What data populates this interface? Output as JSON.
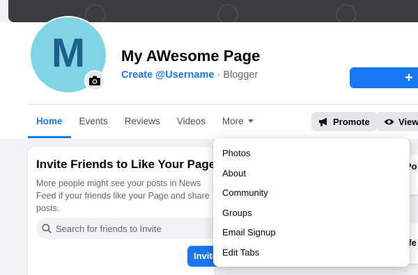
{
  "page": {
    "avatar_letter": "M",
    "name": "My AWesome Page",
    "username_link": "Create @Username",
    "separator": "·",
    "category": "Blogger",
    "primary_action_label": "+"
  },
  "nav": {
    "tabs": [
      {
        "label": "Home",
        "active": true
      },
      {
        "label": "Events"
      },
      {
        "label": "Reviews"
      },
      {
        "label": "Videos"
      },
      {
        "label": "More",
        "has_caret": true
      }
    ],
    "promote_label": "Promote",
    "view_label": "View"
  },
  "invite_card": {
    "title": "Invite Friends to Like Your Page",
    "description": "More people might see your posts in News Feed if your friends like your Page and share posts.",
    "search_placeholder": "Search for friends to Invite",
    "invite_button": "Invite"
  },
  "right_cards": [
    {
      "label": "Po"
    },
    {
      "label": "ffe"
    }
  ],
  "more_menu": {
    "items": [
      "Photos",
      "About",
      "Community",
      "Groups",
      "Email Signup",
      "Edit Tabs"
    ]
  },
  "colors": {
    "accent": "#1877f2",
    "avatar_bg": "#81d4e4",
    "avatar_fg": "#1f5f8a"
  }
}
